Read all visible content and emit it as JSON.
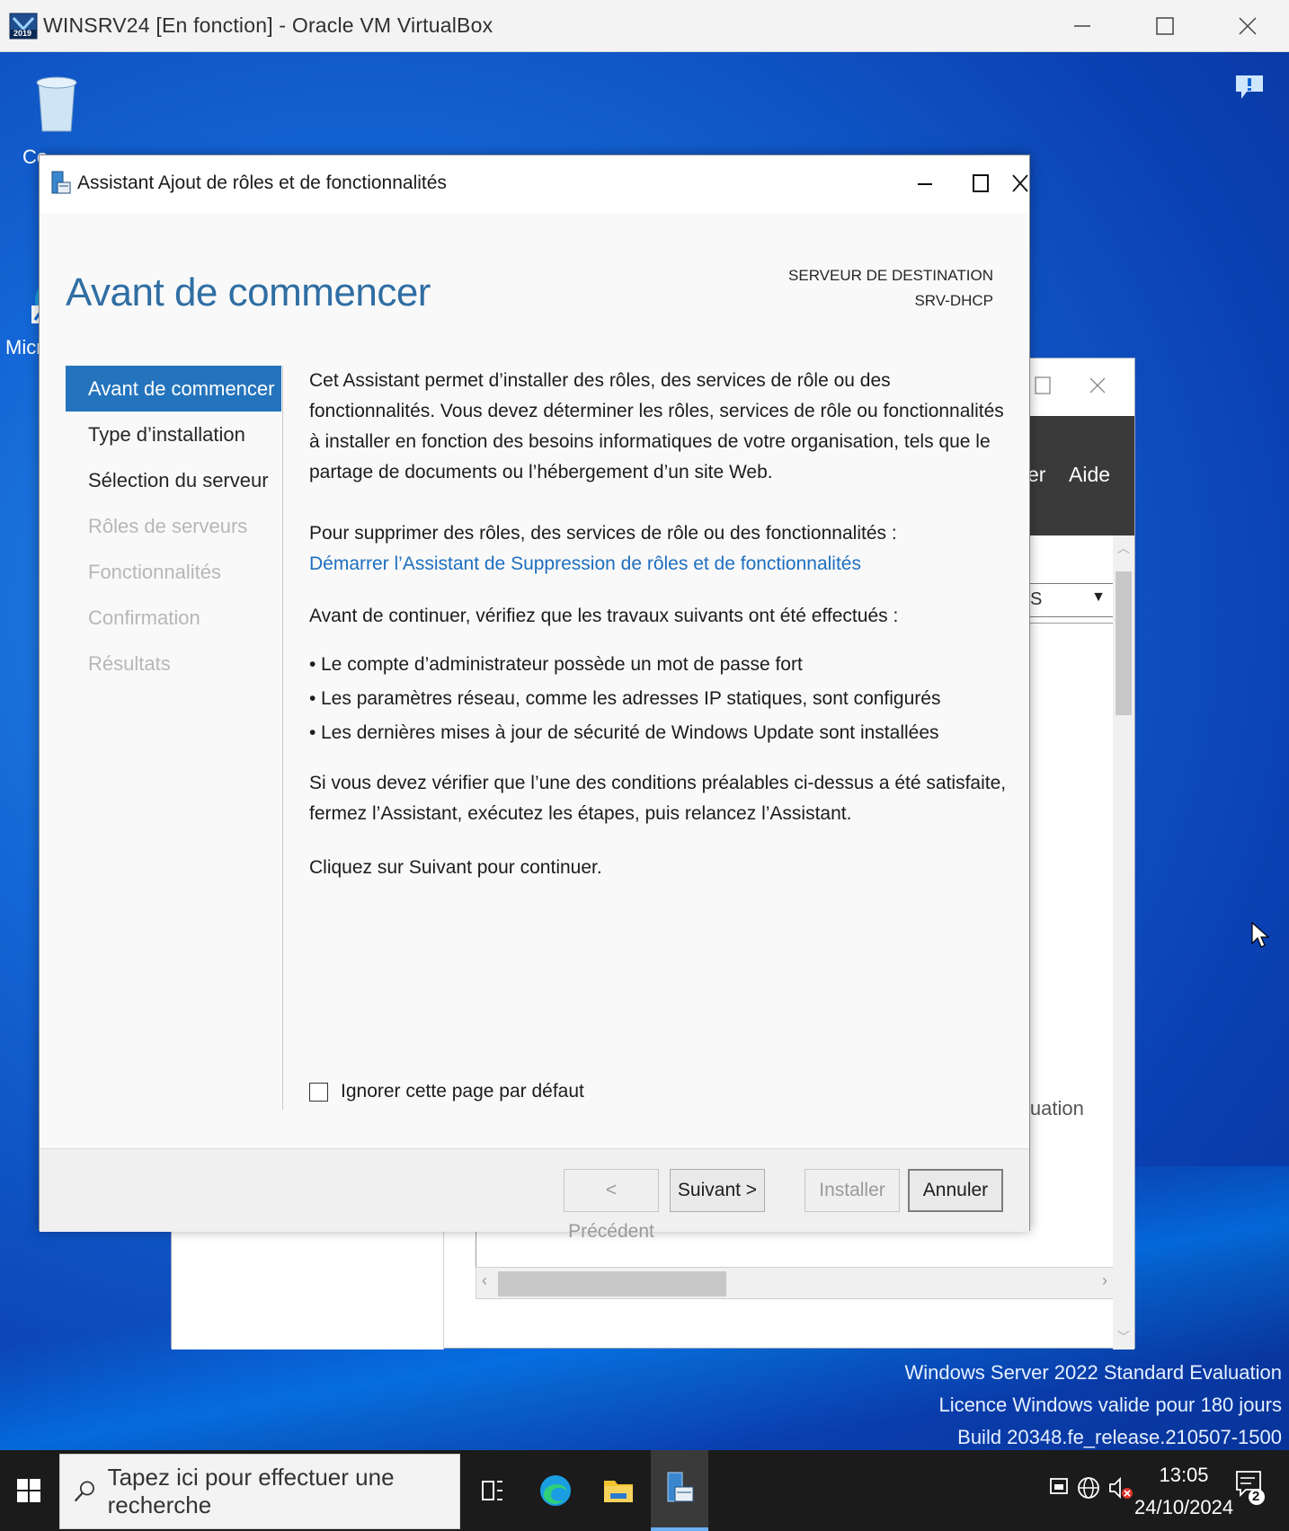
{
  "host": {
    "title": "WINSRV24 [En fonction] - Oracle VM VirtualBox",
    "icon_badge": "2019"
  },
  "desktop": {
    "icons": [
      {
        "label": "Co"
      },
      {
        "label": "Micro"
      }
    ],
    "watermark": [
      "Windows Server 2022 Standard Evaluation",
      "Licence Windows valide pour 180 jours",
      "Build 20348.fe_release.210507-1500"
    ]
  },
  "background_window": {
    "menu_partial": "er",
    "menu_help": "Aide",
    "dropdown_value": "S",
    "partial_text": "luation"
  },
  "wizard": {
    "title": "Assistant Ajout de rôles et de fonctionnalités",
    "heading": "Avant de commencer",
    "destination_label": "SERVEUR DE DESTINATION",
    "destination_value": "SRV-DHCP",
    "nav": [
      {
        "label": "Avant de commencer",
        "state": "active"
      },
      {
        "label": "Type d’installation",
        "state": "enabled"
      },
      {
        "label": "Sélection du serveur",
        "state": "enabled"
      },
      {
        "label": "Rôles de serveurs",
        "state": "disabled"
      },
      {
        "label": "Fonctionnalités",
        "state": "disabled"
      },
      {
        "label": "Confirmation",
        "state": "disabled"
      },
      {
        "label": "Résultats",
        "state": "disabled"
      }
    ],
    "intro": "Cet Assistant permet d’installer des rôles, des services de rôle ou des fonctionnalités. Vous devez déterminer les rôles, services de rôle ou fonctionnalités à installer en fonction des besoins informatiques de votre organisation, tels que le partage de documents ou l’hébergement d’un site Web.",
    "remove_text": "Pour supprimer des rôles, des services de rôle ou des fonctionnalités :",
    "remove_link": "Démarrer l’Assistant de Suppression de rôles et de fonctionnalités",
    "check_text": "Avant de continuer, vérifiez que les travaux suivants ont été effectués :",
    "bullets": [
      "Le compte d’administrateur possède un mot de passe fort",
      "Les paramètres réseau, comme les adresses IP statiques, sont configurés",
      "Les dernières mises à jour de sécurité de Windows Update sont installées"
    ],
    "verify_text": "Si vous devez vérifier que l’une des conditions préalables ci-dessus a été satisfaite, fermez l’Assistant, exécutez les étapes, puis relancez l’Assistant.",
    "next_hint": "Cliquez sur Suivant pour continuer.",
    "skip_checkbox_label": "Ignorer cette page par défaut",
    "skip_checked": false,
    "buttons": {
      "previous": "< Précédent",
      "next": "Suivant >",
      "install": "Installer",
      "cancel": "Annuler"
    }
  },
  "taskbar": {
    "search_placeholder": "Tapez ici pour effectuer une recherche",
    "time": "13:05",
    "date": "24/10/2024",
    "notification_count": "2"
  },
  "colors": {
    "accent": "#2474bd",
    "heading": "#2f6ea3",
    "link": "#1e6fbf",
    "desktop": "#1466d6"
  }
}
